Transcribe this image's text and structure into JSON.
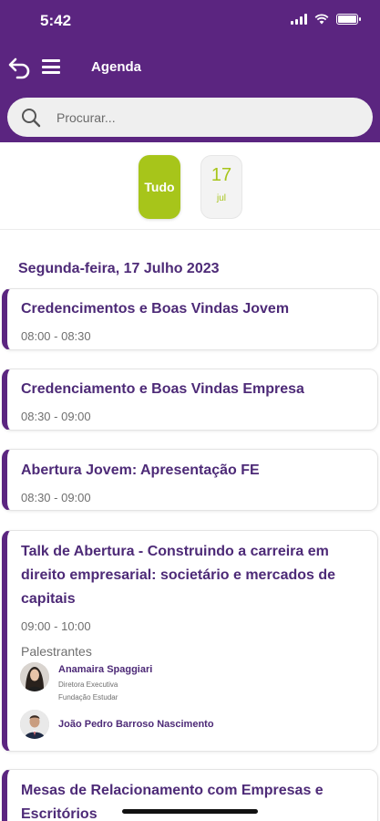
{
  "status_bar": {
    "time": "5:42"
  },
  "nav": {
    "title": "Agenda"
  },
  "search": {
    "placeholder": "Procurar..."
  },
  "date_filter": {
    "all_label": "Tudo",
    "day": {
      "number": "17",
      "month": "jul"
    }
  },
  "colors": {
    "primary": "#5b2580",
    "accent": "#a7c51a",
    "title_text": "#4d2a77"
  },
  "day_heading": "Segunda-feira, 17 Julho 2023",
  "sessions": [
    {
      "title": "Credencimentos e Boas Vindas Jovem",
      "time": "08:00 - 08:30"
    },
    {
      "title": "Credenciamento e Boas Vindas Empresa",
      "time": "08:30 - 09:00"
    },
    {
      "title": "Abertura Jovem: Apresentação FE",
      "time": "08:30 - 09:00"
    },
    {
      "title": "Talk de Abertura - Construindo a carreira em direito empresarial: societário e mercados de capitais",
      "time": "09:00 - 10:00",
      "speakers_label": "Palestrantes",
      "speakers": [
        {
          "name": "Anamaira Spaggiari",
          "role": "Diretora Executiva",
          "org": "Fundação Estudar"
        },
        {
          "name": "João Pedro Barroso Nascimento"
        }
      ]
    },
    {
      "title": "Mesas de Relacionamento com Empresas e Escritórios"
    }
  ]
}
